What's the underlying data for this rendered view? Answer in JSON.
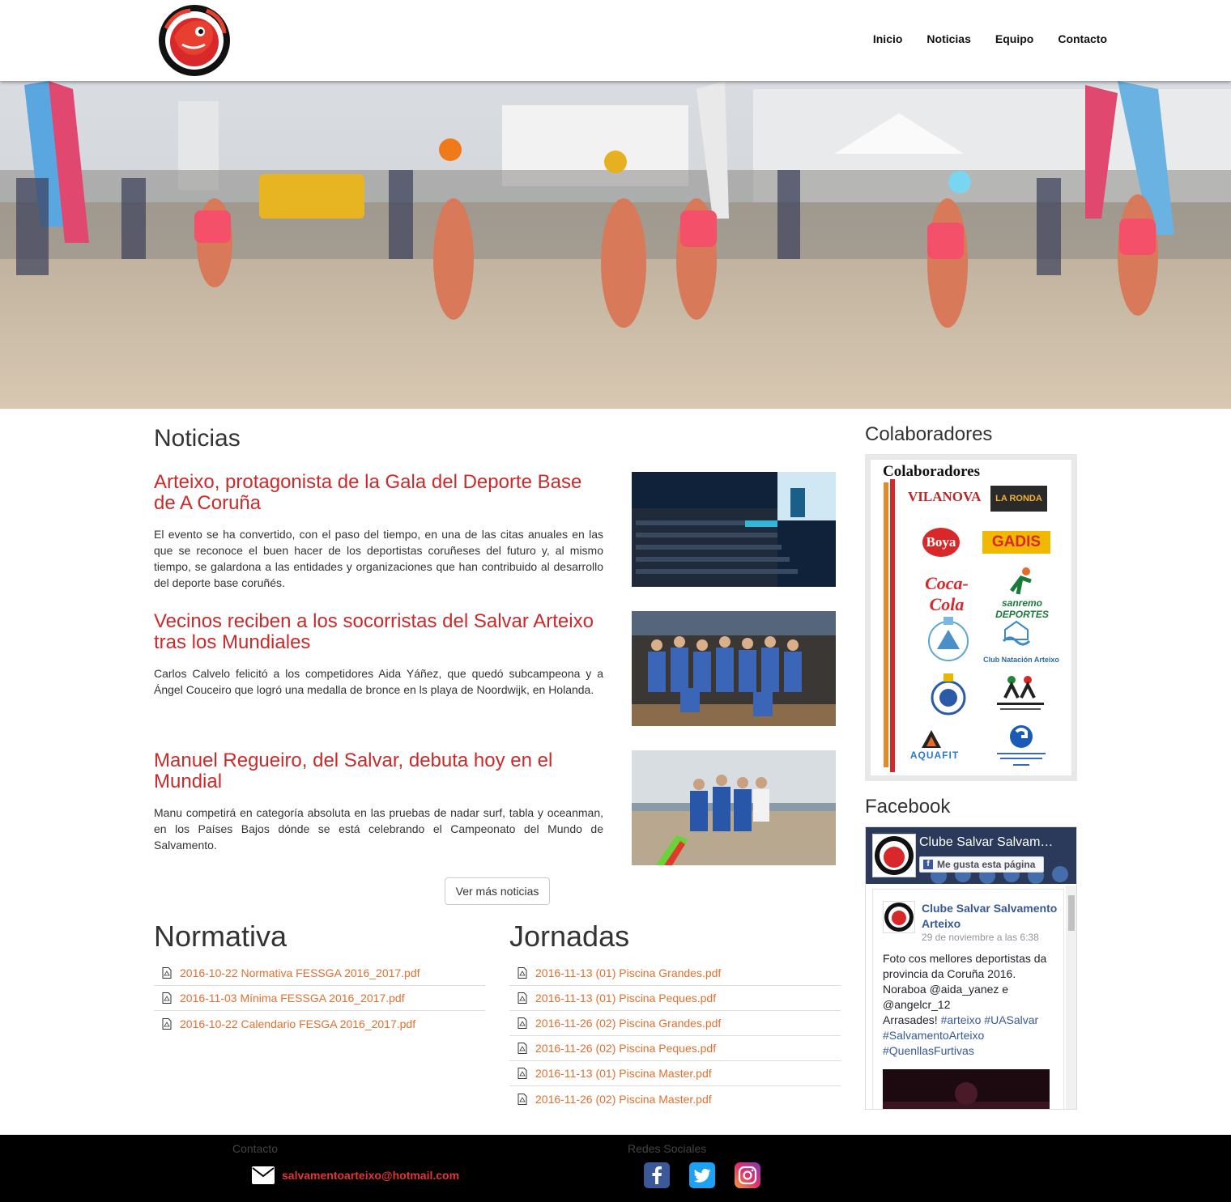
{
  "header": {
    "logo_alt": "Salvar Arteixo logo",
    "nav": [
      "Inicio",
      "Noticias",
      "Equipo",
      "Contacto"
    ]
  },
  "hero": {
    "alt": "Lifeguard beach sprint competition"
  },
  "news": {
    "title": "Noticias",
    "items": [
      {
        "title": "Arteixo, protagonista de la Gala del Deporte Base de A Coruña",
        "text": "El evento se ha convertido, con el paso del tiempo, en una de las citas anuales en las que se reconoce el buen hacer de los deportistas coruñeses del futuro y, al mismo tiempo, se galardona a las entidades y organizaciones que han contribuido al desarrollo del deporte base coruñés."
      },
      {
        "title": "Vecinos reciben a los socorristas del Salvar Arteixo tras los Mundiales",
        "text": "Carlos Calvelo felicitó a los competidores Aida Yáñez, que quedó subcampeona y a Ángel Couceiro que logró una medalla de bronce en ls playa de Noordwijk, en Holanda."
      },
      {
        "title": "Manuel Regueiro, del Salvar, debuta hoy en el Mundial",
        "text": "Manu competirá en categoría absoluta en las pruebas de nadar surf, tabla y oceanman, en los Países Bajos dónde se está celebrando el Campeonato del Mundo de Salvamento."
      }
    ],
    "more_label": "Ver más noticias"
  },
  "normativa": {
    "title": "Normativa",
    "files": [
      "2016-10-22 Normativa FESSGA 2016_2017.pdf",
      "2016-11-03 Mínima FESSGA 2016_2017.pdf",
      "2016-10-22 Calendario FESGA 2016_2017.pdf"
    ]
  },
  "jornadas": {
    "title": "Jornadas",
    "files": [
      "2016-11-13 (01) Piscina Grandes.pdf",
      "2016-11-13 (01) Piscina Peques.pdf",
      "2016-11-26 (02) Piscina Grandes.pdf",
      "2016-11-26 (02) Piscina Peques.pdf",
      "2016-11-13 (01) Piscina Master.pdf",
      "2016-11-26 (02) Piscina Master.pdf"
    ]
  },
  "sidebar": {
    "collab_title": "Colaboradores",
    "collab_image_heading": "Colaboradores",
    "sponsors": [
      "VILANOVA",
      "LA RONDA",
      "Boya",
      "GADIS",
      "Coca-Cola",
      "sanremo DEPORTES",
      "Club Natación Arteixo",
      "AQUAFIT"
    ],
    "facebook_title": "Facebook"
  },
  "facebook": {
    "page_name": "Clube Salvar Salvamento Arteixo",
    "like_label": "Me gusta esta página",
    "post_author": "Clube Salvar Salvamento Arteixo",
    "post_date": "29 de noviembre a las 6:38",
    "post_text": "Foto cos mellores deportistas da provincia da Coruña 2016. Noraboa @aida_yanez e @angelcr_12",
    "post_text2": "Arrasades!",
    "post_tags": [
      "#arteixo",
      "#UASalvar",
      "#SalvamentoArteixo",
      "#QuenllasFurtivas"
    ]
  },
  "footer": {
    "contact_label": "Contacto",
    "email": "salvamentoarteixo@hotmail.com",
    "social_label": "Redes Sociales"
  },
  "colors": {
    "accent_red": "#cc2a2a",
    "link_orange": "#e07030",
    "footer_bg": "#000000",
    "facebook_blue": "#365899"
  }
}
